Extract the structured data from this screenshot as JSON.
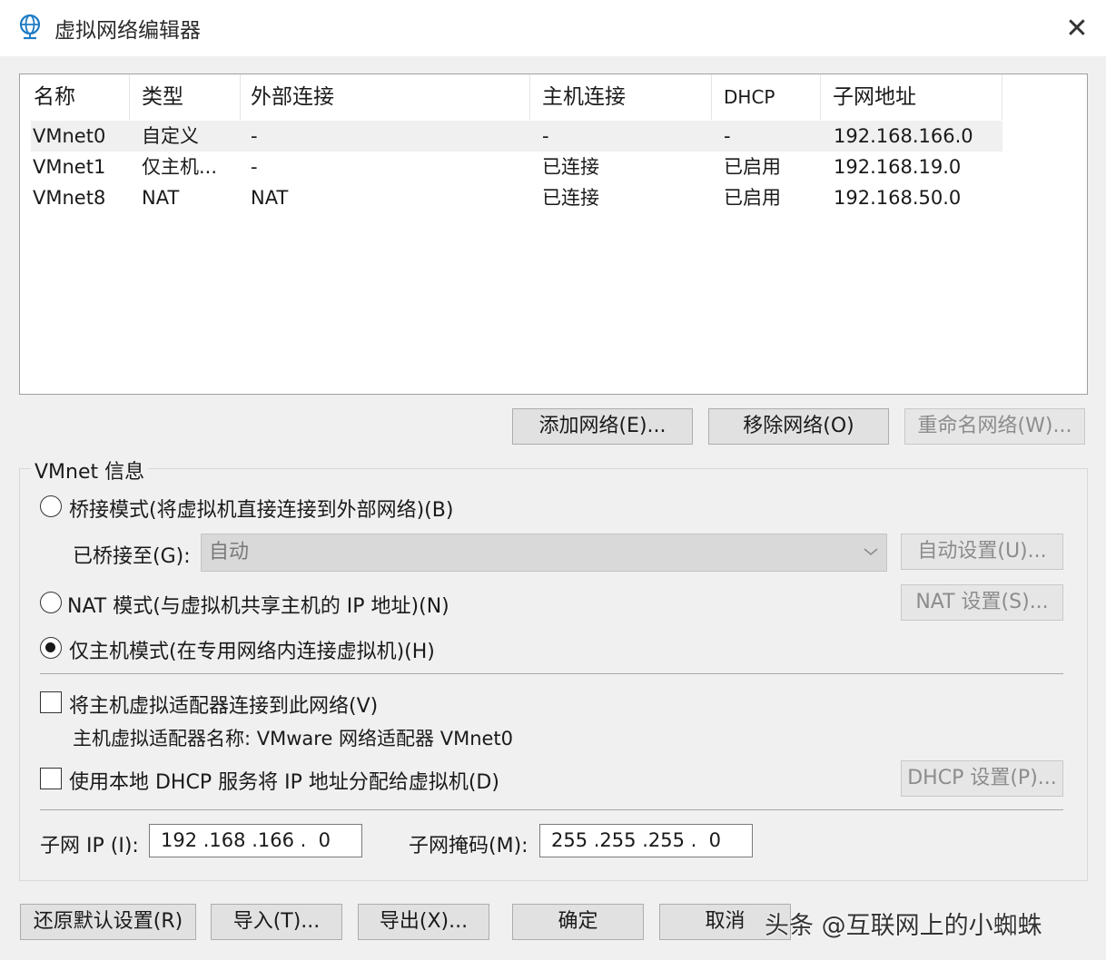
{
  "window": {
    "title": "虚拟网络编辑器",
    "close_glyph": "✕"
  },
  "network_table": {
    "columns": [
      "名称",
      "类型",
      "外部连接",
      "主机连接",
      "DHCP",
      "子网地址"
    ],
    "rows": [
      {
        "name": "VMnet0",
        "type": "自定义",
        "external": "-",
        "host": "-",
        "dhcp": "-",
        "subnet": "192.168.166.0",
        "selected": true
      },
      {
        "name": "VMnet1",
        "type": "仅主机...",
        "external": "-",
        "host": "已连接",
        "dhcp": "已启用",
        "subnet": "192.168.19.0",
        "selected": false
      },
      {
        "name": "VMnet8",
        "type": "NAT",
        "external": "NAT",
        "host": "已连接",
        "dhcp": "已启用",
        "subnet": "192.168.50.0",
        "selected": false
      }
    ]
  },
  "table_buttons": {
    "add": "添加网络(E)...",
    "remove": "移除网络(O)",
    "rename": "重命名网络(W)..."
  },
  "vmnet_info": {
    "group_label": "VMnet 信息",
    "bridged_label": "桥接模式(将虚拟机直接连接到外部网络)(B)",
    "bridged_to_label": "已桥接至(G):",
    "bridged_to_value": "自动",
    "auto_settings_button": "自动设置(U)...",
    "nat_label": "NAT 模式(与虚拟机共享主机的 IP 地址)(N)",
    "nat_settings_button": "NAT 设置(S)...",
    "host_only_label": "仅主机模式(在专用网络内连接虚拟机)(H)",
    "selected_mode": "host_only",
    "connect_adapter_label": "将主机虚拟适配器连接到此网络(V)",
    "connect_adapter_checked": false,
    "adapter_name_text": "主机虚拟适配器名称: VMware 网络适配器 VMnet0",
    "dhcp_label": "使用本地 DHCP 服务将 IP 地址分配给虚拟机(D)",
    "dhcp_checked": false,
    "dhcp_settings_button": "DHCP 设置(P)...",
    "subnet_ip_label": "子网 IP (I):",
    "subnet_ip_value": "192 .168 .166 .  0",
    "subnet_mask_label": "子网掩码(M):",
    "subnet_mask_value": "255 .255 .255 .  0"
  },
  "footer_buttons": {
    "restore": "还原默认设置(R)",
    "import": "导入(T)...",
    "export": "导出(X)...",
    "ok": "确定",
    "cancel": "取消"
  },
  "watermark": "头条 @互联网上的小蜘蛛",
  "colors": {
    "dialog_bg": "#f0f0f0",
    "list_bg": "#ffffff",
    "selected_row": "#f0f0f0",
    "button_bg": "#e1e1e1",
    "disabled_text": "#8c8c8c"
  }
}
